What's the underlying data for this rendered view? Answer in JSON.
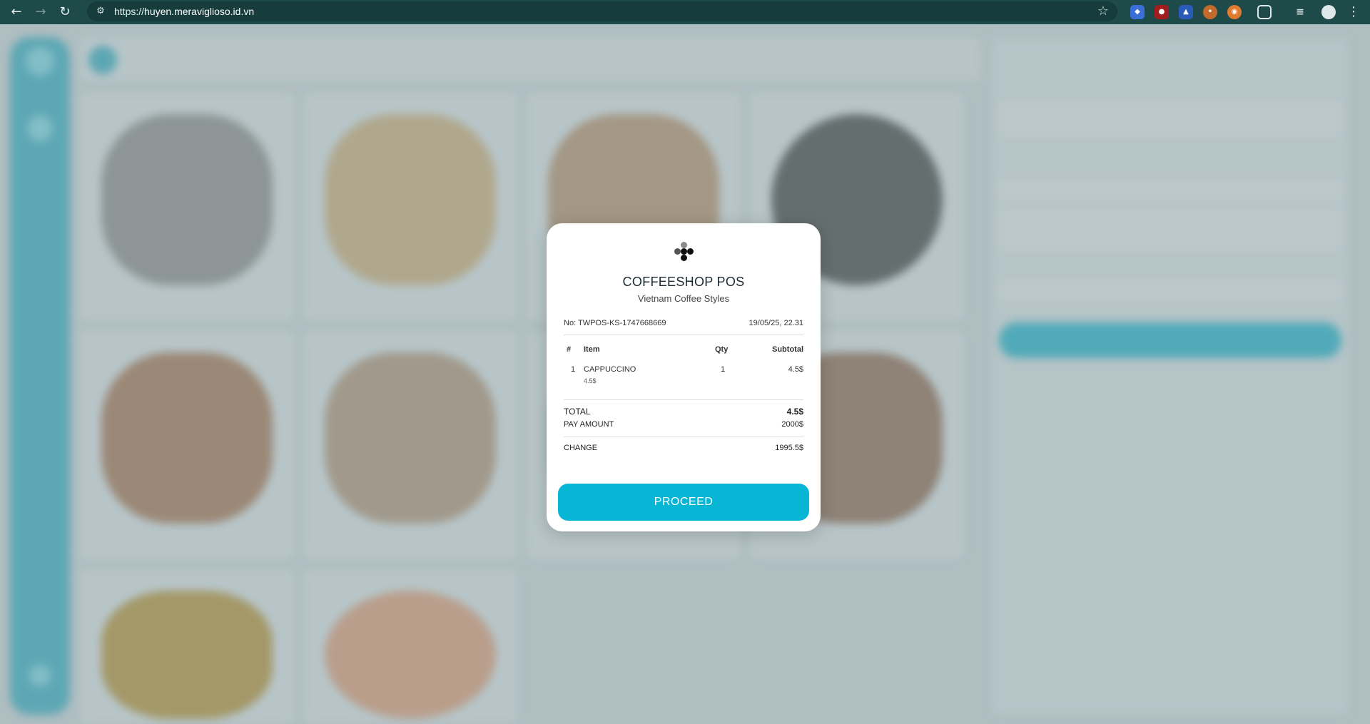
{
  "browser": {
    "back_icon": "←",
    "forward_icon": "→",
    "reload_icon": "↻",
    "site_info_icon": "⚙",
    "url_scheme": "https://",
    "url_host": "huyen.meraviglioso.id.vn",
    "star_icon": "☆",
    "menu_icon": "⋮"
  },
  "receipt": {
    "title": "COFFEESHOP POS",
    "subtitle": "Vietnam Coffee Styles",
    "order_no": "No: TWPOS-KS-1747668669",
    "datetime": "19/05/25, 22.31",
    "columns": {
      "index": "#",
      "item": "Item",
      "qty": "Qty",
      "subtotal": "Subtotal"
    },
    "items": [
      {
        "index": "1",
        "name": "CAPPUCCINO",
        "unit_price": "4.5$",
        "qty": "1",
        "subtotal": "4.5$"
      }
    ],
    "total_label": "TOTAL",
    "total_value": "4.5$",
    "pay_label": "PAY AMOUNT",
    "pay_value": "2000$",
    "change_label": "CHANGE",
    "change_value": "1995.5$",
    "proceed_label": "PROCEED"
  },
  "colors": {
    "chrome": "#1f4a4a",
    "accent": "#06b6d4",
    "sidebar": "#4aa6b6"
  }
}
